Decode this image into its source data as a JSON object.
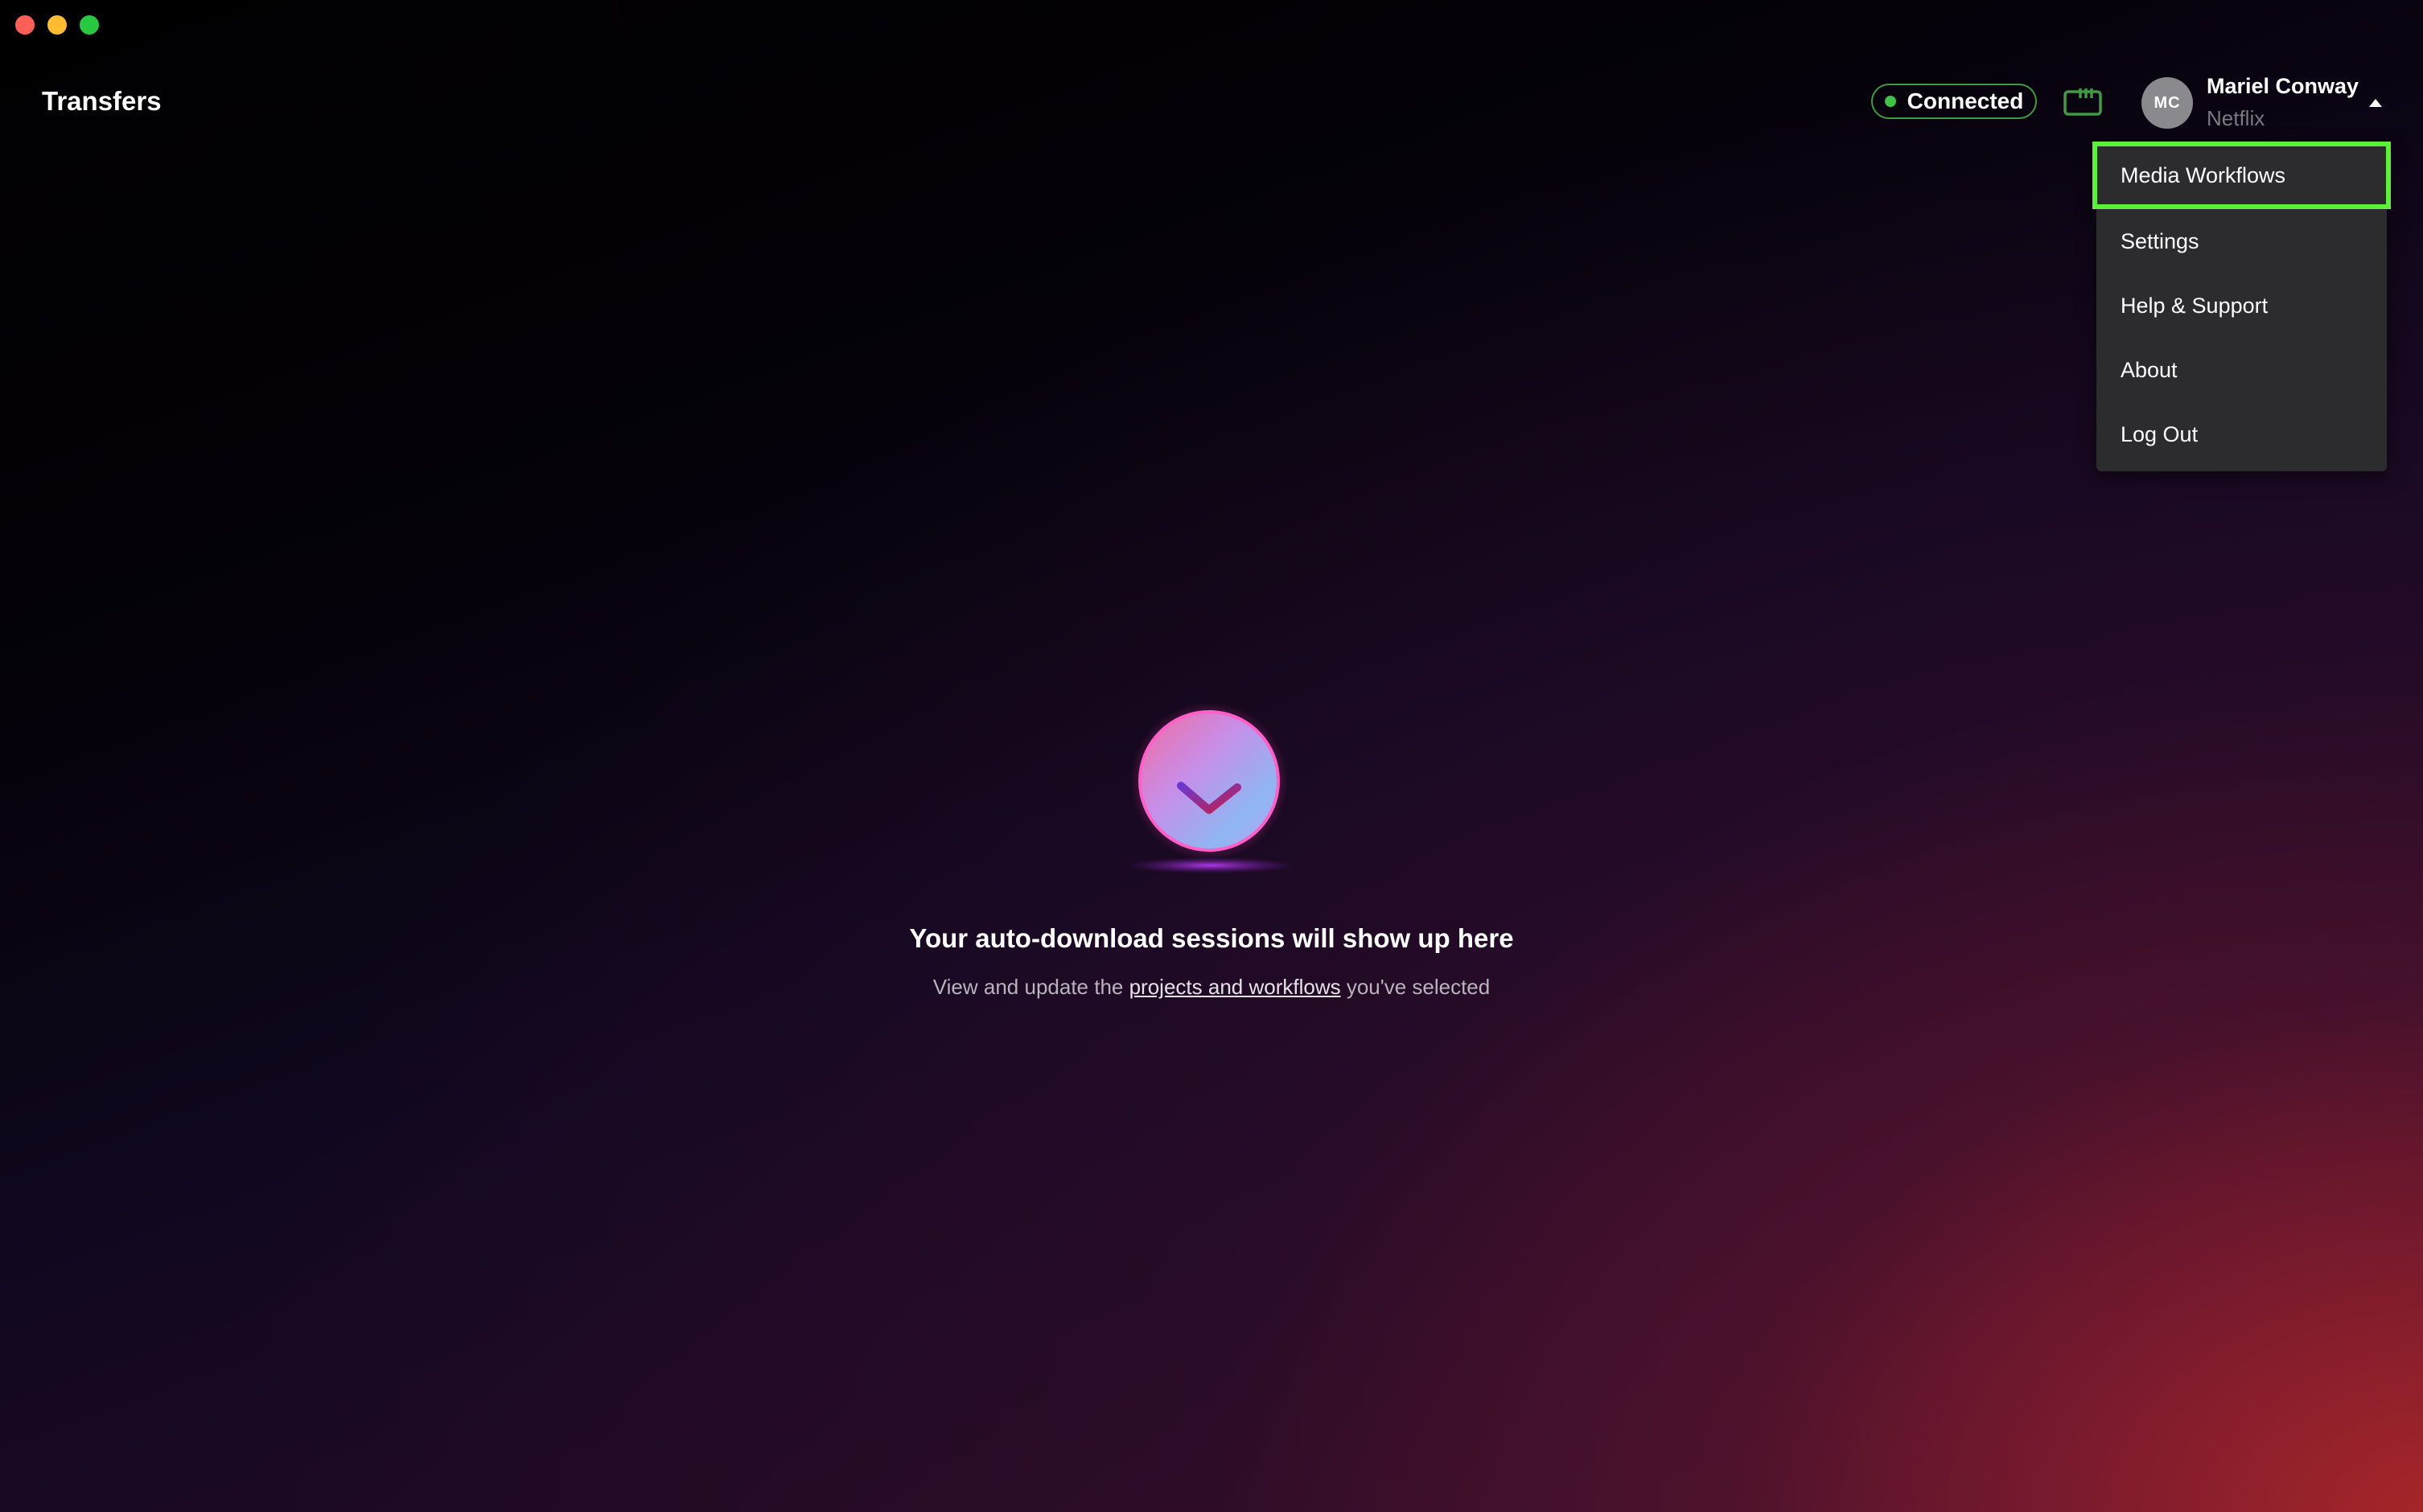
{
  "window": {
    "controls": [
      "close",
      "minimize",
      "zoom"
    ]
  },
  "header": {
    "title": "Transfers",
    "status": {
      "label": "Connected",
      "color": "#3fc248"
    },
    "storage_icon": "storage-icon",
    "user": {
      "initials": "MC",
      "name": "Mariel Conway",
      "organization": "Netflix"
    }
  },
  "dropdown": {
    "items": [
      {
        "label": "Media Workflows",
        "highlighted": true
      },
      {
        "label": "Settings"
      },
      {
        "label": "Help & Support"
      },
      {
        "label": "About"
      },
      {
        "label": "Log Out"
      }
    ],
    "highlight_color": "#5cf03a"
  },
  "empty_state": {
    "icon": "download-arrow-icon",
    "heading": "Your auto-download sessions will show up here",
    "sub_prefix": "View and update the ",
    "sub_link": "projects and workflows",
    "sub_suffix": " you've selected"
  }
}
